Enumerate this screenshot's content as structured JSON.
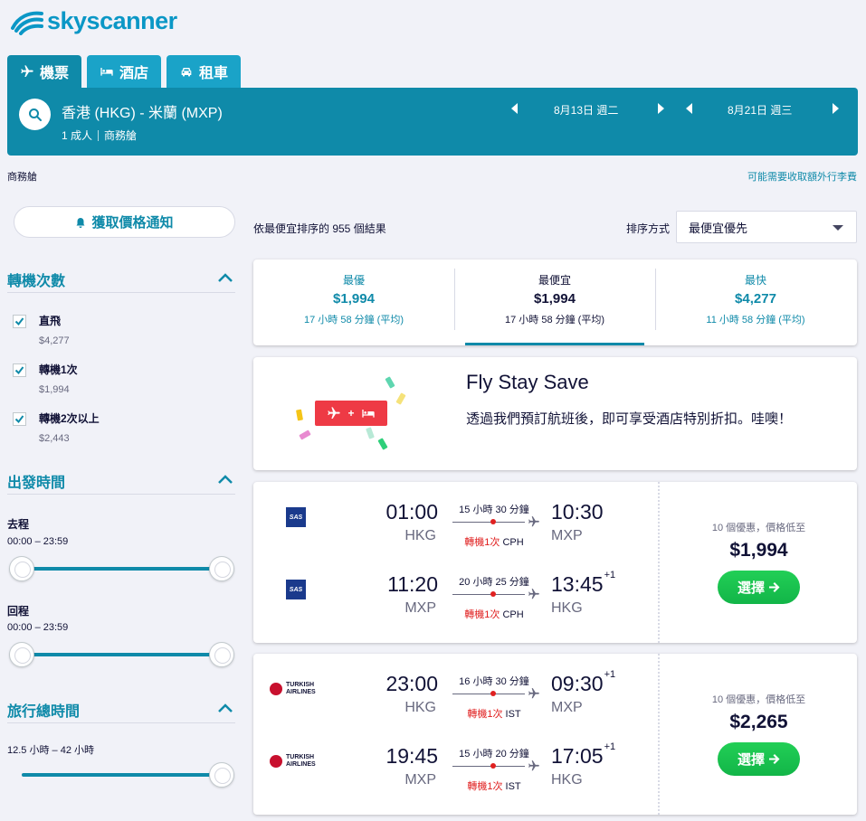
{
  "brand": {
    "name": "skyscanner",
    "color": "#0b97c6"
  },
  "tabs": [
    {
      "label": "機票",
      "icon": "plane-icon",
      "active": true
    },
    {
      "label": "酒店",
      "icon": "bed-icon",
      "active": false
    },
    {
      "label": "租車",
      "icon": "car-icon",
      "active": false
    }
  ],
  "search": {
    "route": "香港 (HKG) - 米蘭 (MXP)",
    "passengers": "1 成人",
    "cabin": "商務艙",
    "depart_date": "8月13日 週二",
    "return_date": "8月21日 週三"
  },
  "cabin_note": "商務艙",
  "fees_link": "可能需要收取額外行李費",
  "price_alert": "獲取價格通知",
  "filters": {
    "stops": {
      "title": "轉機次數",
      "items": [
        {
          "label": "直飛",
          "price": "$4,277",
          "checked": true
        },
        {
          "label": "轉機1次",
          "price": "$1,994",
          "checked": true
        },
        {
          "label": "轉機2次以上",
          "price": "$2,443",
          "checked": true
        }
      ]
    },
    "times": {
      "title": "出發時間",
      "outbound_label": "去程",
      "outbound_range": "00:00 – 23:59",
      "return_label": "回程",
      "return_range": "00:00 – 23:59"
    },
    "duration": {
      "title": "旅行總時間",
      "range": "12.5 小時 – 42 小時"
    }
  },
  "results": {
    "count_text": "依最便宜排序的 955 個結果",
    "sort_label": "排序方式",
    "sort_value": "最便宜優先"
  },
  "summary": [
    {
      "title": "最優",
      "price": "$1,994",
      "duration": "17 小時 58 分鐘 (平均)"
    },
    {
      "title": "最便宜",
      "price": "$1,994",
      "duration": "17 小時 58 分鐘 (平均)",
      "active": true
    },
    {
      "title": "最快",
      "price": "$4,277",
      "duration": "11 小時 58 分鐘 (平均)"
    }
  ],
  "promo": {
    "title": "Fly Stay Save",
    "text": "透過我們預訂航班後，即可享受酒店特別折扣。哇噢！",
    "badge_plus": "+"
  },
  "flights": [
    {
      "airline": "SAS",
      "deals": "10 個優惠，價格低至",
      "price": "$1,994",
      "select": "選擇",
      "legs": [
        {
          "dep_time": "01:00",
          "dep_airport": "HKG",
          "arr_time": "10:30",
          "arr_plus": "",
          "arr_airport": "MXP",
          "duration": "15 小時 30 分鐘",
          "stops": "轉機1次",
          "via": "CPH"
        },
        {
          "dep_time": "11:20",
          "dep_airport": "MXP",
          "arr_time": "13:45",
          "arr_plus": "+1",
          "arr_airport": "HKG",
          "duration": "20 小時 25 分鐘",
          "stops": "轉機1次",
          "via": "CPH"
        }
      ]
    },
    {
      "airline": "TURKISH AIRLINES",
      "airline_l1": "TURKISH",
      "airline_l2": "AIRLINES",
      "deals": "10 個優惠，價格低至",
      "price": "$2,265",
      "select": "選擇",
      "legs": [
        {
          "dep_time": "23:00",
          "dep_airport": "HKG",
          "arr_time": "09:30",
          "arr_plus": "+1",
          "arr_airport": "MXP",
          "duration": "16 小時 30 分鐘",
          "stops": "轉機1次",
          "via": "IST"
        },
        {
          "dep_time": "19:45",
          "dep_airport": "MXP",
          "arr_time": "17:05",
          "arr_plus": "+1",
          "arr_airport": "HKG",
          "duration": "15 小時 20 分鐘",
          "stops": "轉機1次",
          "via": "IST"
        }
      ]
    }
  ],
  "colors": {
    "primary": "#0f8aa9",
    "accent_green": "#1dc74d",
    "stop_red": "#e02020",
    "promo_red": "#ee3a45"
  }
}
